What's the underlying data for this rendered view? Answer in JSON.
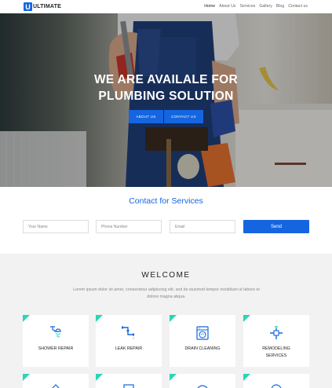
{
  "header": {
    "logo_letter": "U",
    "logo_text": "ULTIMATE",
    "nav": [
      "Home",
      "About Us",
      "Services",
      "Gallery",
      "Blog",
      "Contact us"
    ],
    "active_nav": "Home"
  },
  "hero": {
    "title_line1": "WE ARE AVAILALE FOR",
    "title_line2": "PLUMBING SOLUTION",
    "btn_about": "ABOUT US",
    "btn_contact": "CONTACT US"
  },
  "contact": {
    "title": "Contact for Services",
    "name_placeholder": "Your Name",
    "phone_placeholder": "Phone Number",
    "email_placeholder": "Email",
    "send": "Send"
  },
  "welcome": {
    "title": "WELCOME",
    "text": "Lorem ipsum dolor sit amet, consectetur adipiscing elit, sed do eiusmod tempor incididunt ut labore et dolore magna aliqua."
  },
  "services": [
    {
      "label": "SHOWER REPAIR",
      "icon": "shower-icon"
    },
    {
      "label": "LEAK REPAIR",
      "icon": "pipe-leak-icon"
    },
    {
      "label": "DRAIN CLEANING",
      "icon": "washing-machine-icon"
    },
    {
      "label": "REMODELING SERVICES",
      "icon": "pipe-valve-icon"
    }
  ],
  "colors": {
    "brand_blue": "#1565e0",
    "card_accent": "#29d6b6",
    "section_gray": "#f2f2f2"
  }
}
